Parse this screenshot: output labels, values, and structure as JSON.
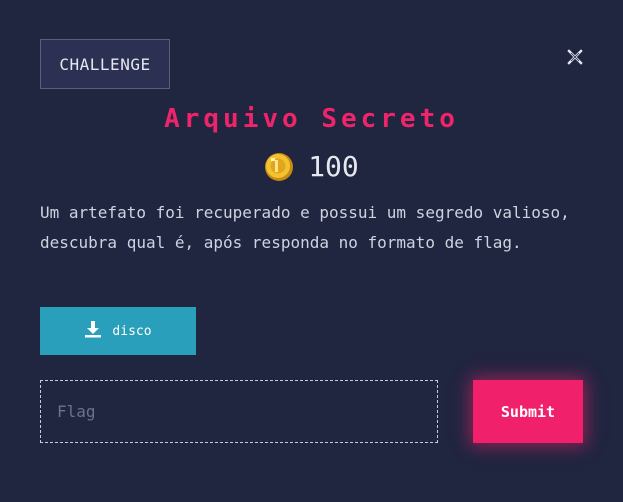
{
  "dialog": {
    "tab_label": "CHALLENGE",
    "close_icon": "close-icon",
    "title": "Arquivo Secreto",
    "coin_icon": "coin-icon",
    "value": "100",
    "description": "Um artefato foi recuperado e possui um segredo valioso, descubra qual é, após responda no formato de flag.",
    "download": {
      "icon": "download-icon",
      "label": "disco"
    },
    "flag_input": {
      "placeholder": "Flag",
      "value": ""
    },
    "submit_label": "Submit"
  },
  "colors": {
    "background": "#202540",
    "title": "#f0246a",
    "download_button": "#2a9fbb",
    "submit_button": "#f0216a",
    "coin": "#f2c230"
  }
}
